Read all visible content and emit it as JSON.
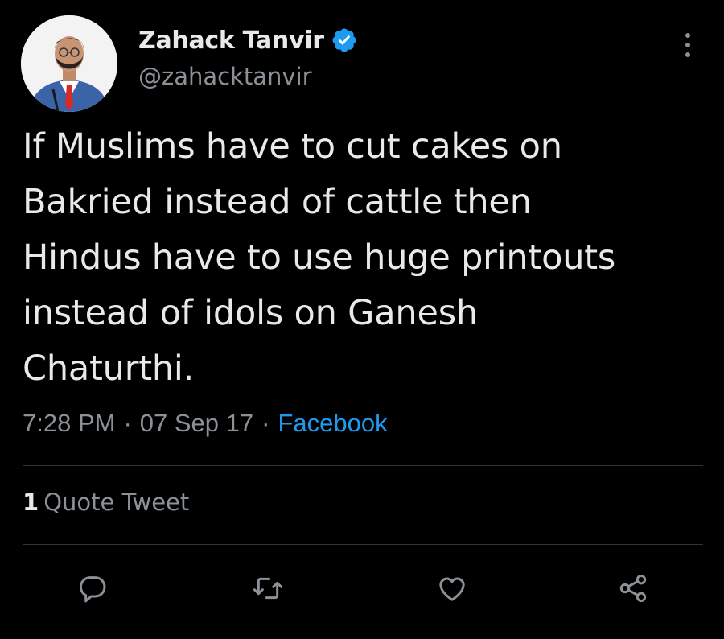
{
  "author": {
    "display_name": "Zahack Tanvir",
    "handle": "@zahacktanvir",
    "verified": true,
    "avatar_icon": "profile-photo"
  },
  "tweet": {
    "text": "If Muslims have to cut cakes on\nBakried instead of cattle then\nHindus have to use huge printouts\ninstead of idols on Ganesh\nChaturthi.",
    "time": "7:28 PM",
    "separator": "·",
    "date": "07 Sep 17",
    "source": "Facebook"
  },
  "stats": {
    "quote_count": "1",
    "quote_label": "Quote Tweet"
  },
  "actions": [
    {
      "icon": "reply-icon"
    },
    {
      "icon": "retweet-icon"
    },
    {
      "icon": "like-icon"
    },
    {
      "icon": "share-icon"
    }
  ],
  "colors": {
    "background": "#000000",
    "text": "#e7e9ea",
    "muted": "#8b9196",
    "accent": "#1d9bf0",
    "divider": "#2f3336"
  }
}
